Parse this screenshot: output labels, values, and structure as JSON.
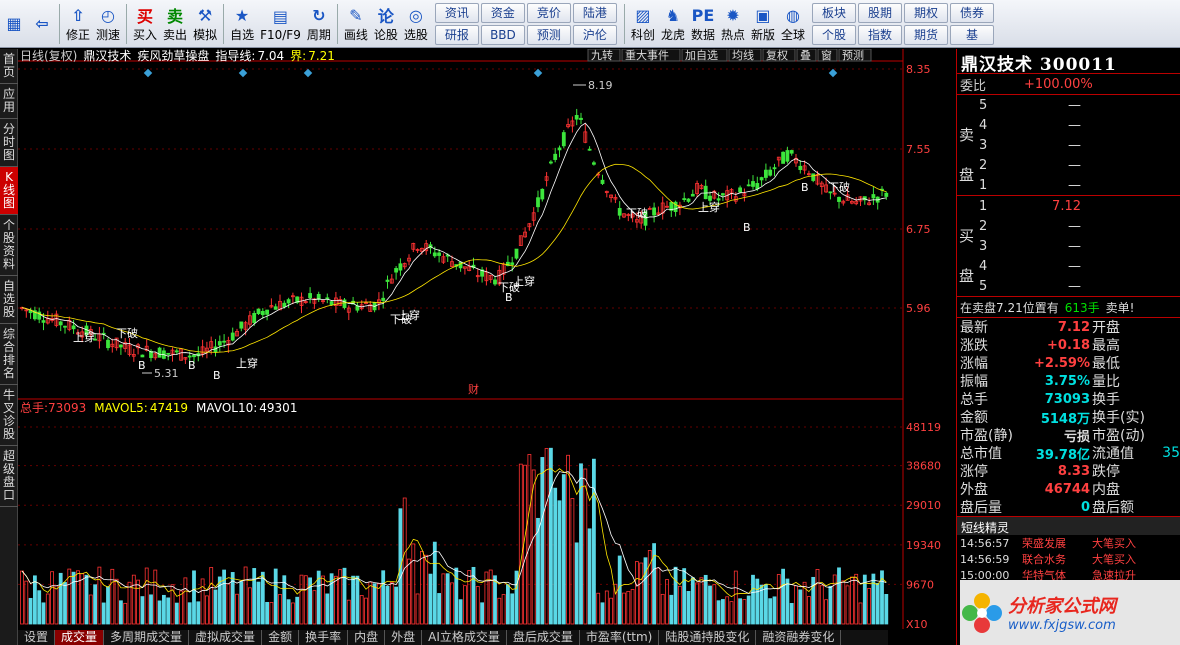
{
  "toolbar": {
    "items": [
      {
        "label": "",
        "icon": "grid-app-icon"
      },
      {
        "label": "",
        "icon": "back-arrow-icon"
      },
      {
        "label": "修正",
        "icon": "up-arrow-icon"
      },
      {
        "label": "测速",
        "icon": "clock-icon"
      },
      {
        "label": "买入",
        "icon": "buy-icon",
        "glyph": "买"
      },
      {
        "label": "卖出",
        "icon": "sell-icon",
        "glyph": "卖"
      },
      {
        "label": "模拟",
        "icon": "hammer-icon"
      },
      {
        "label": "自选",
        "icon": "star-icon"
      },
      {
        "label": "F10/F9",
        "icon": "f10-icon"
      },
      {
        "label": "周期",
        "icon": "cycle-icon"
      },
      {
        "label": "画线",
        "icon": "pencil-icon"
      },
      {
        "label": "论股",
        "icon": "discuss-icon",
        "glyph": "论"
      },
      {
        "label": "选股",
        "icon": "select-stock-icon"
      }
    ],
    "quick": [
      "资讯",
      "资金",
      "竞价",
      "陆港",
      "研报",
      "BBD",
      "预测",
      "沪伦"
    ],
    "items2": [
      {
        "label": "科创",
        "icon": "kechuang-icon"
      },
      {
        "label": "龙虎",
        "icon": "dragon-tiger-icon"
      },
      {
        "label": "数据",
        "icon": "pe-icon",
        "glyph": "PE"
      },
      {
        "label": "热点",
        "icon": "hot-icon"
      },
      {
        "label": "新版",
        "icon": "new-version-icon"
      },
      {
        "label": "全球",
        "icon": "globe-icon"
      }
    ],
    "quick2": [
      "板块",
      "股期",
      "期权",
      "债券",
      "个股",
      "指数",
      "期货",
      "基"
    ]
  },
  "leftnav": [
    "首页",
    "应用",
    "分时图",
    "K线图",
    "个股资料",
    "自选股",
    "综合排名",
    "牛叉诊股",
    "超级盘口"
  ],
  "leftnav_active": 3,
  "header": {
    "period": "日线(复权)",
    "name": "鼎汉技术",
    "indicator": "疾风劲草操盘",
    "guide_label": "指导线:",
    "guide_val": "7.04",
    "bound_label": "界:",
    "bound_val": "7.21"
  },
  "header_buttons": [
    "九转",
    "重大事件",
    "加自选",
    "均线",
    "复权",
    "叠",
    "窗",
    "预测"
  ],
  "price_axis": [
    "8.35",
    "7.55",
    "6.75",
    "5.96"
  ],
  "vol_axis": [
    "48119",
    "38680",
    "29010",
    "19340",
    "9670",
    "X10"
  ],
  "volume_header": {
    "total_label": "总手:",
    "total": "73093",
    "mavol5_label": "MAVOL5:",
    "mavol5": "47419",
    "mavol10_label": "MAVOL10:",
    "mavol10": "49301"
  },
  "annotations": {
    "high": "8.19",
    "low": "5.31",
    "cai": "财",
    "shangchuan": "上穿",
    "xiapo": "下破",
    "b": "B"
  },
  "chart_data": {
    "type": "candlestick",
    "title": "鼎汉技术 300011 日线(复权)",
    "ylim": [
      5.15,
      8.35
    ],
    "volume_ylim": [
      0,
      48119
    ],
    "high": 8.19,
    "low": 5.31,
    "last": 7.12
  },
  "right": {
    "title": "鼎汉技术 300011",
    "weibi_label": "委比",
    "weibi": "+100.00%",
    "sell_label": "卖盘",
    "buy_label": "买盘",
    "sell": [
      {
        "n": "5",
        "p": "—"
      },
      {
        "n": "4",
        "p": "—"
      },
      {
        "n": "3",
        "p": "—"
      },
      {
        "n": "2",
        "p": "—"
      },
      {
        "n": "1",
        "p": "—"
      }
    ],
    "buy": [
      {
        "n": "1",
        "p": "7.12"
      },
      {
        "n": "2",
        "p": "—"
      },
      {
        "n": "3",
        "p": "—"
      },
      {
        "n": "4",
        "p": "—"
      },
      {
        "n": "5",
        "p": "—"
      }
    ],
    "notice": "在卖盘7.21位置有",
    "notice_num": "613手",
    "notice_tail": "卖单!",
    "stats": [
      {
        "l": "最新",
        "v": "7.12",
        "c": "up",
        "l2": "开盘",
        "v2": ""
      },
      {
        "l": "涨跌",
        "v": "+0.18",
        "c": "up",
        "l2": "最高",
        "v2": ""
      },
      {
        "l": "涨幅",
        "v": "+2.59%",
        "c": "up",
        "l2": "最低",
        "v2": ""
      },
      {
        "l": "振幅",
        "v": "3.75%",
        "c": "cy",
        "l2": "量比",
        "v2": ""
      },
      {
        "l": "总手",
        "v": "73093",
        "c": "cy",
        "l2": "换手",
        "v2": ""
      },
      {
        "l": "金额",
        "v": "5148万",
        "c": "cy",
        "l2": "换手(实)",
        "v2": ""
      },
      {
        "l": "市盈(静)",
        "v": "亏损",
        "c": "wh",
        "l2": "市盈(动)",
        "v2": ""
      },
      {
        "l": "总市值",
        "v": "39.78亿",
        "c": "cy",
        "l2": "流通值",
        "v2": "35"
      },
      {
        "l": "涨停",
        "v": "8.33",
        "c": "up",
        "l2": "跌停",
        "v2": ""
      },
      {
        "l": "外盘",
        "v": "46744",
        "c": "up",
        "l2": "内盘",
        "v2": ""
      },
      {
        "l": "盘后量",
        "v": "0",
        "c": "cy",
        "l2": "盘后额",
        "v2": ""
      }
    ],
    "dx_title": "短线精灵",
    "dx": [
      {
        "t": "14:56:57",
        "n": "荣盛发展",
        "e": "大笔买入"
      },
      {
        "t": "14:56:59",
        "n": "联合水务",
        "e": "大笔买入"
      },
      {
        "t": "15:00:00",
        "n": "华特气体",
        "e": "急速拉升"
      }
    ]
  },
  "bottom_tabs": [
    "设置",
    "成交量",
    "多周期成交量",
    "虚拟成交量",
    "金额",
    "换手率",
    "内盘",
    "外盘",
    "AI立格成交量",
    "盘后成交量",
    "市盈率(ttm)",
    "陆股通持股变化",
    "融资融券变化"
  ],
  "bottom_active": 1,
  "watermark": {
    "title": "分析家公式网",
    "url": "www.fxjgsw.com"
  }
}
